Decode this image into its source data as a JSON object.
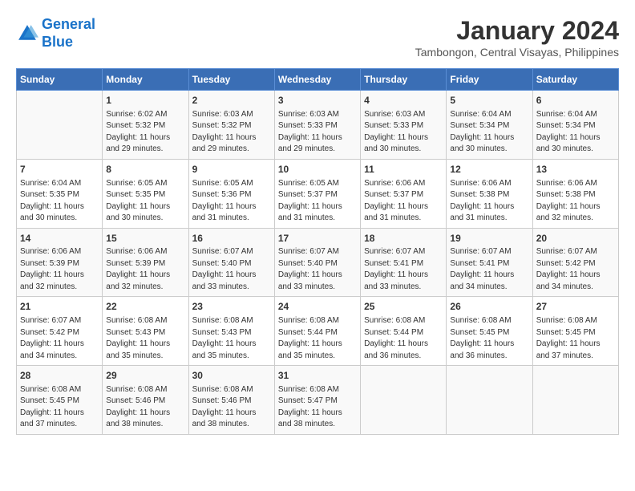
{
  "header": {
    "logo_text_general": "General",
    "logo_text_blue": "Blue",
    "main_title": "January 2024",
    "subtitle": "Tambongon, Central Visayas, Philippines"
  },
  "calendar": {
    "columns": [
      "Sunday",
      "Monday",
      "Tuesday",
      "Wednesday",
      "Thursday",
      "Friday",
      "Saturday"
    ],
    "rows": [
      [
        {
          "day": "",
          "info": ""
        },
        {
          "day": "1",
          "info": "Sunrise: 6:02 AM\nSunset: 5:32 PM\nDaylight: 11 hours\nand 29 minutes."
        },
        {
          "day": "2",
          "info": "Sunrise: 6:03 AM\nSunset: 5:32 PM\nDaylight: 11 hours\nand 29 minutes."
        },
        {
          "day": "3",
          "info": "Sunrise: 6:03 AM\nSunset: 5:33 PM\nDaylight: 11 hours\nand 29 minutes."
        },
        {
          "day": "4",
          "info": "Sunrise: 6:03 AM\nSunset: 5:33 PM\nDaylight: 11 hours\nand 30 minutes."
        },
        {
          "day": "5",
          "info": "Sunrise: 6:04 AM\nSunset: 5:34 PM\nDaylight: 11 hours\nand 30 minutes."
        },
        {
          "day": "6",
          "info": "Sunrise: 6:04 AM\nSunset: 5:34 PM\nDaylight: 11 hours\nand 30 minutes."
        }
      ],
      [
        {
          "day": "7",
          "info": "Sunrise: 6:04 AM\nSunset: 5:35 PM\nDaylight: 11 hours\nand 30 minutes."
        },
        {
          "day": "8",
          "info": "Sunrise: 6:05 AM\nSunset: 5:35 PM\nDaylight: 11 hours\nand 30 minutes."
        },
        {
          "day": "9",
          "info": "Sunrise: 6:05 AM\nSunset: 5:36 PM\nDaylight: 11 hours\nand 31 minutes."
        },
        {
          "day": "10",
          "info": "Sunrise: 6:05 AM\nSunset: 5:37 PM\nDaylight: 11 hours\nand 31 minutes."
        },
        {
          "day": "11",
          "info": "Sunrise: 6:06 AM\nSunset: 5:37 PM\nDaylight: 11 hours\nand 31 minutes."
        },
        {
          "day": "12",
          "info": "Sunrise: 6:06 AM\nSunset: 5:38 PM\nDaylight: 11 hours\nand 31 minutes."
        },
        {
          "day": "13",
          "info": "Sunrise: 6:06 AM\nSunset: 5:38 PM\nDaylight: 11 hours\nand 32 minutes."
        }
      ],
      [
        {
          "day": "14",
          "info": "Sunrise: 6:06 AM\nSunset: 5:39 PM\nDaylight: 11 hours\nand 32 minutes."
        },
        {
          "day": "15",
          "info": "Sunrise: 6:06 AM\nSunset: 5:39 PM\nDaylight: 11 hours\nand 32 minutes."
        },
        {
          "day": "16",
          "info": "Sunrise: 6:07 AM\nSunset: 5:40 PM\nDaylight: 11 hours\nand 33 minutes."
        },
        {
          "day": "17",
          "info": "Sunrise: 6:07 AM\nSunset: 5:40 PM\nDaylight: 11 hours\nand 33 minutes."
        },
        {
          "day": "18",
          "info": "Sunrise: 6:07 AM\nSunset: 5:41 PM\nDaylight: 11 hours\nand 33 minutes."
        },
        {
          "day": "19",
          "info": "Sunrise: 6:07 AM\nSunset: 5:41 PM\nDaylight: 11 hours\nand 34 minutes."
        },
        {
          "day": "20",
          "info": "Sunrise: 6:07 AM\nSunset: 5:42 PM\nDaylight: 11 hours\nand 34 minutes."
        }
      ],
      [
        {
          "day": "21",
          "info": "Sunrise: 6:07 AM\nSunset: 5:42 PM\nDaylight: 11 hours\nand 34 minutes."
        },
        {
          "day": "22",
          "info": "Sunrise: 6:08 AM\nSunset: 5:43 PM\nDaylight: 11 hours\nand 35 minutes."
        },
        {
          "day": "23",
          "info": "Sunrise: 6:08 AM\nSunset: 5:43 PM\nDaylight: 11 hours\nand 35 minutes."
        },
        {
          "day": "24",
          "info": "Sunrise: 6:08 AM\nSunset: 5:44 PM\nDaylight: 11 hours\nand 35 minutes."
        },
        {
          "day": "25",
          "info": "Sunrise: 6:08 AM\nSunset: 5:44 PM\nDaylight: 11 hours\nand 36 minutes."
        },
        {
          "day": "26",
          "info": "Sunrise: 6:08 AM\nSunset: 5:45 PM\nDaylight: 11 hours\nand 36 minutes."
        },
        {
          "day": "27",
          "info": "Sunrise: 6:08 AM\nSunset: 5:45 PM\nDaylight: 11 hours\nand 37 minutes."
        }
      ],
      [
        {
          "day": "28",
          "info": "Sunrise: 6:08 AM\nSunset: 5:45 PM\nDaylight: 11 hours\nand 37 minutes."
        },
        {
          "day": "29",
          "info": "Sunrise: 6:08 AM\nSunset: 5:46 PM\nDaylight: 11 hours\nand 38 minutes."
        },
        {
          "day": "30",
          "info": "Sunrise: 6:08 AM\nSunset: 5:46 PM\nDaylight: 11 hours\nand 38 minutes."
        },
        {
          "day": "31",
          "info": "Sunrise: 6:08 AM\nSunset: 5:47 PM\nDaylight: 11 hours\nand 38 minutes."
        },
        {
          "day": "",
          "info": ""
        },
        {
          "day": "",
          "info": ""
        },
        {
          "day": "",
          "info": ""
        }
      ]
    ]
  }
}
